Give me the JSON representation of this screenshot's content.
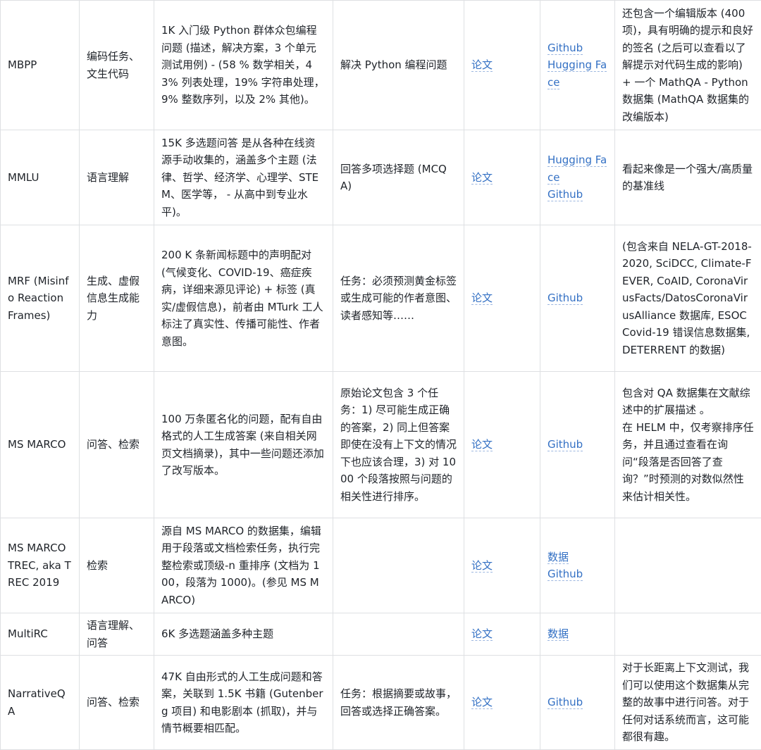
{
  "rows": [
    {
      "name": "MBPP",
      "capability": "编码任务、文生代码",
      "description": "1K 入门级 Python 群体众包编程问题 (描述，解决方案，3 个单元测试用例) - (58 % 数学相关，43% 列表处理，19% 字符串处理，9% 整数序列，以及 2% 其他)。",
      "task": "解决 Python 编程问题",
      "paper": "论文",
      "links": [
        "Github",
        "Hugging Face"
      ],
      "notes": [
        "还包含一个编辑版本 (400 项)，具有明确的提示和良好的签名 (之后可以查看以了解提示对代码生成的影响) + 一个 MathQA - Python 数据集 (MathQA 数据集的改编版本)"
      ]
    },
    {
      "name": "MMLU",
      "capability": "语言理解",
      "description": "15K 多选题问答 是从各种在线资源手动收集的，涵盖多个主题 (法律、哲学、经济学、心理学、STEM、医学等， - 从高中到专业水平)。",
      "task": "回答多项选择题 (MCQA)",
      "paper": "论文",
      "links": [
        "Hugging Face",
        "Github"
      ],
      "notes": [
        "看起来像是一个强大/高质量的基准线"
      ]
    },
    {
      "name": "MRF (Misinfo Reaction Frames)",
      "capability": "生成、虚假信息生成能力",
      "description": "200 K 条新闻标题中的声明配对 (气候变化、COVID-19、癌症疾病，详细来源见评论) + 标签 (真实/虚假信息)，前者由 MTurk 工人标注了真实性、传播可能性、作者意图。",
      "task": "任务：必须预测黄金标签或生成可能的作者意图、读者感知等……",
      "paper": "论文",
      "links": [
        "Github"
      ],
      "notes": [
        "(包含来自 NELA-GT-2018-2020, SciDCC, Climate-FEVER, CoAID, CoronaVirusFacts/DatosCoronaVirusAlliance 数据库, ESOC Covid-19 错误信息数据集, DETERRENT 的数据)"
      ]
    },
    {
      "name": "MS MARCO",
      "capability": "问答、检索",
      "description": "100 万条匿名化的问题，配有自由格式的人工生成答案 (来自相关网页文档摘录)，其中一些问题还添加了改写版本。",
      "task": "原始论文包含 3 个任务：1) 尽可能生成正确的答案，2) 同上但答案即使在没有上下文的情况下也应该合理，3) 对 1000 个段落按照与问题的相关性进行排序。",
      "paper": "论文",
      "links": [
        "Github"
      ],
      "notes": [
        "包含对 QA 数据集在文献综述中的扩展描述 。",
        "在 HELM 中，仅考察排序任务，并且通过查看在询问“段落是否回答了查询？”时预测的对数似然性来估计相关性。"
      ]
    },
    {
      "name": "MS MARCO TREC, aka TREC 2019",
      "capability": "检索",
      "description": "源自 MS MARCO 的数据集，编辑用于段落或文档检索任务，执行完整检索或顶级-n 重排序 (文档为 100，段落为 1000)。(参见 MS MARCO)",
      "task": "",
      "paper": "论文",
      "links": [
        "数据",
        "Github"
      ],
      "notes": []
    },
    {
      "name": "MultiRC",
      "capability": "语言理解、问答",
      "description": "6K 多选题涵盖多种主题",
      "task": "",
      "paper": "论文",
      "links": [
        "数据"
      ],
      "notes": []
    },
    {
      "name": "NarrativeQA",
      "capability": "问答、检索",
      "description": "47K 自由形式的人工生成问题和答案，关联到 1.5K 书籍 (Gutenberg 项目) 和电影剧本 (抓取)，并与情节概要相匹配。",
      "task": "任务：根据摘要或故事，回答或选择正确答案。",
      "paper": "论文",
      "links": [
        "Github"
      ],
      "notes": [
        "对于长距离上下文测试，我们可以使用这个数据集从完整的故事中进行问答。对于任何对话系统而言，这可能都很有趣。"
      ]
    }
  ]
}
